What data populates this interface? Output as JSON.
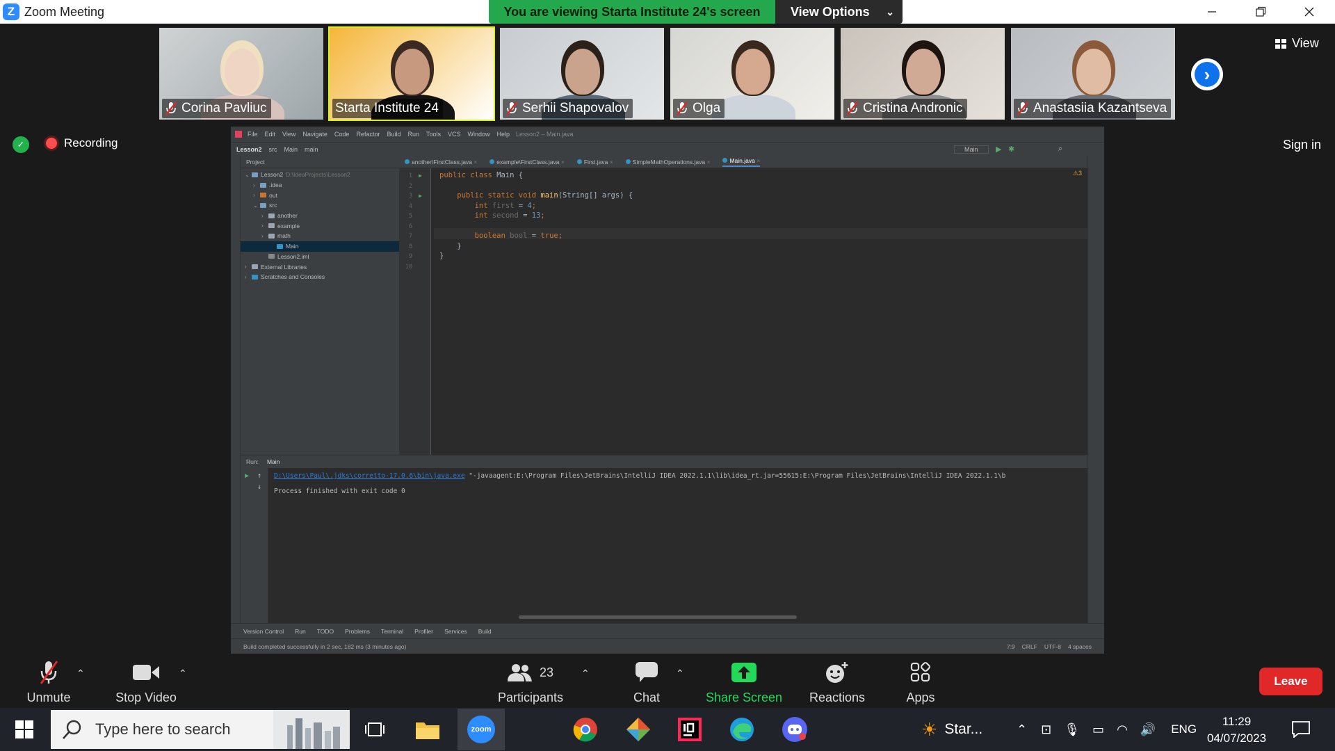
{
  "window": {
    "title": "Zoom Meeting",
    "logo_letter": "Z"
  },
  "banner": {
    "viewing_text": "You are viewing Starta Institute 24's screen",
    "view_options_label": "View Options"
  },
  "participants": [
    {
      "name": "Corina Pavliuc",
      "muted": true
    },
    {
      "name": "Starta Institute 24",
      "muted": false,
      "active": true
    },
    {
      "name": "Serhii Shapovalov",
      "muted": true
    },
    {
      "name": "Olga",
      "muted": true
    },
    {
      "name": "Cristina Andronic",
      "muted": true
    },
    {
      "name": "Anastasiia Kazantseva",
      "muted": true
    }
  ],
  "view_label": "View",
  "sign_in_label": "Sign in",
  "recording_label": "Recording",
  "ide": {
    "menu": [
      "File",
      "Edit",
      "View",
      "Navigate",
      "Code",
      "Refactor",
      "Build",
      "Run",
      "Tools",
      "VCS",
      "Window",
      "Help"
    ],
    "window_title": "Lesson2 – Main.java",
    "breadcrumb": [
      "Lesson2",
      "src",
      "Main",
      "main"
    ],
    "run_config": "Main",
    "project_label": "Project",
    "tree": [
      {
        "label": "Lesson2",
        "suffix": "D:\\IdeaProjects\\Lesson2",
        "level": 0,
        "arrow": "⌄",
        "color": "#7a9ec2"
      },
      {
        "label": ".idea",
        "level": 1,
        "arrow": "›",
        "color": "#7a9ec2"
      },
      {
        "label": "out",
        "level": 1,
        "arrow": "›",
        "color": "#c87533"
      },
      {
        "label": "src",
        "level": 1,
        "arrow": "⌄",
        "color": "#7a9ec2"
      },
      {
        "label": "another",
        "level": 2,
        "arrow": "›",
        "color": "#9aa5b1"
      },
      {
        "label": "example",
        "level": 2,
        "arrow": "›",
        "color": "#9aa5b1"
      },
      {
        "label": "math",
        "level": 2,
        "arrow": "›",
        "color": "#9aa5b1"
      },
      {
        "label": "Main",
        "level": 3,
        "arrow": "",
        "color": "#3592c4",
        "selected": true
      },
      {
        "label": "Lesson2.iml",
        "level": 2,
        "arrow": "",
        "color": "#888888"
      },
      {
        "label": "External Libraries",
        "level": 0,
        "arrow": "›",
        "color": "#9aa5b1"
      },
      {
        "label": "Scratches and Consoles",
        "level": 0,
        "arrow": "›",
        "color": "#3592c4"
      }
    ],
    "tabs": [
      {
        "label": "another\\FirstClass.java",
        "active": false
      },
      {
        "label": "example\\FirstClass.java",
        "active": false
      },
      {
        "label": "First.java",
        "active": false
      },
      {
        "label": "SimpleMathOperations.java",
        "active": false
      },
      {
        "label": "Main.java",
        "active": true
      }
    ],
    "warnings": "⚠3",
    "code_lines": [
      {
        "n": "1",
        "parts": [
          {
            "t": "public class ",
            "c": "kw"
          },
          {
            "t": "Main {",
            "c": ""
          }
        ]
      },
      {
        "n": "2",
        "parts": []
      },
      {
        "n": "3",
        "parts": [
          {
            "t": "    public static void ",
            "c": "kw"
          },
          {
            "t": "main",
            "c": "fn"
          },
          {
            "t": "(String[] args) {",
            "c": ""
          }
        ]
      },
      {
        "n": "4",
        "parts": [
          {
            "t": "        int ",
            "c": "kw"
          },
          {
            "t": "first",
            "c": "var"
          },
          {
            "t": " = ",
            "c": ""
          },
          {
            "t": "4",
            "c": "num"
          },
          {
            "t": ";",
            "c": "kw"
          }
        ]
      },
      {
        "n": "5",
        "parts": [
          {
            "t": "        int ",
            "c": "kw"
          },
          {
            "t": "second",
            "c": "var"
          },
          {
            "t": " = ",
            "c": ""
          },
          {
            "t": "13",
            "c": "num"
          },
          {
            "t": ";",
            "c": "kw"
          }
        ]
      },
      {
        "n": "6",
        "parts": []
      },
      {
        "n": "7",
        "parts": [
          {
            "t": "        boolean ",
            "c": "kw"
          },
          {
            "t": "bool",
            "c": "var"
          },
          {
            "t": " = ",
            "c": ""
          },
          {
            "t": "true",
            "c": "kw"
          },
          {
            "t": ";",
            "c": "kw"
          }
        ]
      },
      {
        "n": "8",
        "parts": [
          {
            "t": "    }",
            "c": ""
          }
        ]
      },
      {
        "n": "9",
        "parts": [
          {
            "t": "}",
            "c": ""
          }
        ]
      },
      {
        "n": "10",
        "parts": []
      }
    ],
    "run_label": "Run:",
    "run_tab": "Main",
    "run_output_link": "D:\\Users\\Paul\\.jdks\\corretto-17.0.6\\bin\\java.exe",
    "run_output_rest": " \"-javaagent:E:\\Program Files\\JetBrains\\IntelliJ IDEA 2022.1.1\\lib\\idea_rt.jar=55615:E:\\Program Files\\JetBrains\\IntelliJ IDEA 2022.1.1\\b",
    "run_output_finished": "Process finished with exit code 0",
    "bottom_tabs": [
      "Version Control",
      "Run",
      "TODO",
      "Problems",
      "Terminal",
      "Profiler",
      "Services",
      "Build"
    ],
    "status_text": "Build completed successfully in 2 sec, 182 ms (3 minutes ago)",
    "status_right": [
      "7:9",
      "CRLF",
      "UTF-8",
      "4 spaces"
    ]
  },
  "toolbar": {
    "unmute": "Unmute",
    "stop_video": "Stop Video",
    "participants": "Participants",
    "participants_count": "23",
    "chat": "Chat",
    "share_screen": "Share Screen",
    "reactions": "Reactions",
    "apps": "Apps",
    "leave": "Leave"
  },
  "taskbar": {
    "search_placeholder": "Type here to search",
    "zoom_label": "zoom",
    "weather_label": "Star...",
    "lang": "ENG",
    "time": "11:29",
    "date": "04/07/2023"
  },
  "colors": {
    "zoom_blue": "#2D8CFF",
    "banner_green": "#23a84d",
    "leave_red": "#e02828",
    "share_green": "#23d959",
    "active_border": "#d4f020"
  }
}
